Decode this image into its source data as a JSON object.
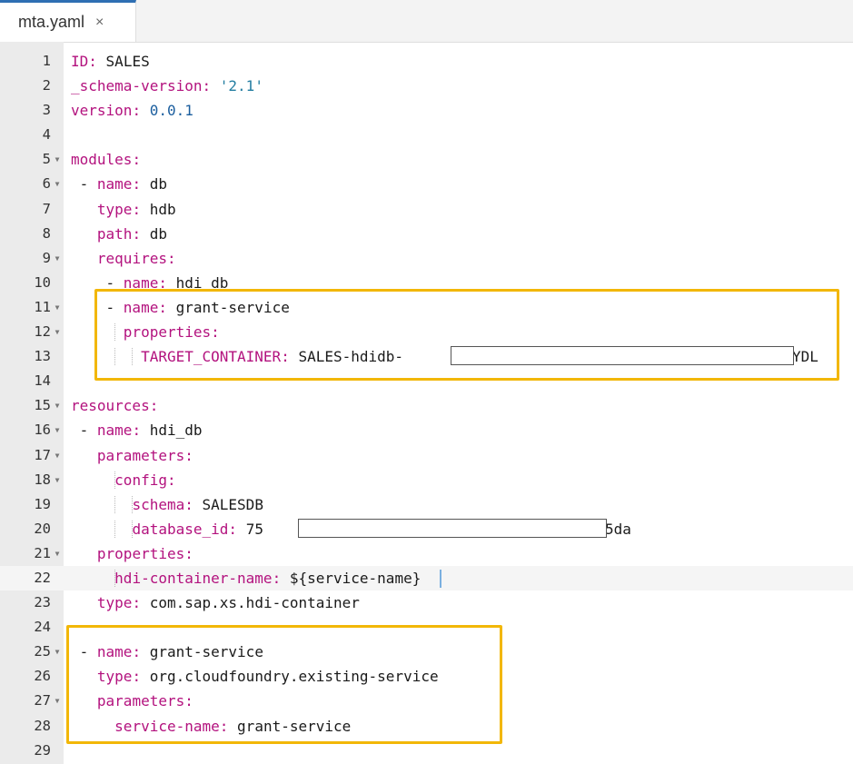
{
  "tab": {
    "label": "mta.yaml",
    "close_glyph": "×"
  },
  "lines": [
    {
      "n": "1",
      "fold": false,
      "indent": "",
      "key": "ID",
      "val": "SALES",
      "vclass": "v"
    },
    {
      "n": "2",
      "fold": false,
      "indent": "",
      "key": "_schema-version",
      "val": "'2.1'",
      "vclass": "s"
    },
    {
      "n": "3",
      "fold": false,
      "indent": "",
      "key": "version",
      "val": "0.0.1",
      "vclass": "n"
    },
    {
      "n": "4",
      "fold": false,
      "indent": "",
      "key": "",
      "val": "",
      "vclass": "v"
    },
    {
      "n": "5",
      "fold": true,
      "indent": "",
      "key": "modules",
      "val": "",
      "vclass": "v"
    },
    {
      "n": "6",
      "fold": true,
      "indent": " - ",
      "key": "name",
      "val": "db",
      "vclass": "v"
    },
    {
      "n": "7",
      "fold": false,
      "indent": "   ",
      "key": "type",
      "val": "hdb",
      "vclass": "v"
    },
    {
      "n": "8",
      "fold": false,
      "indent": "   ",
      "key": "path",
      "val": "db",
      "vclass": "v"
    },
    {
      "n": "9",
      "fold": true,
      "indent": "   ",
      "key": "requires",
      "val": "",
      "vclass": "v"
    },
    {
      "n": "10",
      "fold": false,
      "indent": "    - ",
      "key": "name",
      "val": "hdi_db",
      "vclass": "v"
    },
    {
      "n": "11",
      "fold": true,
      "indent": "    - ",
      "key": "name",
      "val": "grant-service",
      "vclass": "v"
    },
    {
      "n": "12",
      "fold": true,
      "indent": "      ",
      "key": "properties",
      "val": "",
      "vclass": "v"
    },
    {
      "n": "13",
      "fold": false,
      "indent": "        ",
      "key": "TARGET_CONTAINER",
      "val": "SALES-hdidb-",
      "vclass": "v",
      "tail": "YDL"
    },
    {
      "n": "14",
      "fold": false,
      "indent": "",
      "key": "",
      "val": "",
      "vclass": "v"
    },
    {
      "n": "15",
      "fold": true,
      "indent": "",
      "key": "resources",
      "val": "",
      "vclass": "v"
    },
    {
      "n": "16",
      "fold": true,
      "indent": " - ",
      "key": "name",
      "val": "hdi_db",
      "vclass": "v"
    },
    {
      "n": "17",
      "fold": true,
      "indent": "   ",
      "key": "parameters",
      "val": "",
      "vclass": "v"
    },
    {
      "n": "18",
      "fold": true,
      "indent": "     ",
      "key": "config",
      "val": "",
      "vclass": "v"
    },
    {
      "n": "19",
      "fold": false,
      "indent": "       ",
      "key": "schema",
      "val": "SALESDB",
      "vclass": "v"
    },
    {
      "n": "20",
      "fold": false,
      "indent": "       ",
      "key": "database_id",
      "val": "75",
      "vclass": "v",
      "tail": "5da"
    },
    {
      "n": "21",
      "fold": true,
      "indent": "   ",
      "key": "properties",
      "val": "",
      "vclass": "v"
    },
    {
      "n": "22",
      "fold": false,
      "indent": "     ",
      "key": "hdi-container-name",
      "val": "${service-name}",
      "vclass": "v"
    },
    {
      "n": "23",
      "fold": false,
      "indent": "   ",
      "key": "type",
      "val": "com.sap.xs.hdi-container",
      "vclass": "v"
    },
    {
      "n": "24",
      "fold": false,
      "indent": "",
      "key": "",
      "val": "",
      "vclass": "v"
    },
    {
      "n": "25",
      "fold": true,
      "indent": " - ",
      "key": "name",
      "val": "grant-service",
      "vclass": "v"
    },
    {
      "n": "26",
      "fold": false,
      "indent": "   ",
      "key": "type",
      "val": "org.cloudfoundry.existing-service",
      "vclass": "v"
    },
    {
      "n": "27",
      "fold": true,
      "indent": "   ",
      "key": "parameters",
      "val": "",
      "vclass": "v"
    },
    {
      "n": "28",
      "fold": false,
      "indent": "     ",
      "key": "service-name",
      "val": "grant-service",
      "vclass": "v"
    },
    {
      "n": "29",
      "fold": false,
      "indent": "",
      "key": "",
      "val": "",
      "vclass": "v"
    }
  ],
  "colors": {
    "highlight": "#f2b708",
    "keyword": "#b3127e",
    "string": "#237da1",
    "number": "#1b5e9e"
  }
}
